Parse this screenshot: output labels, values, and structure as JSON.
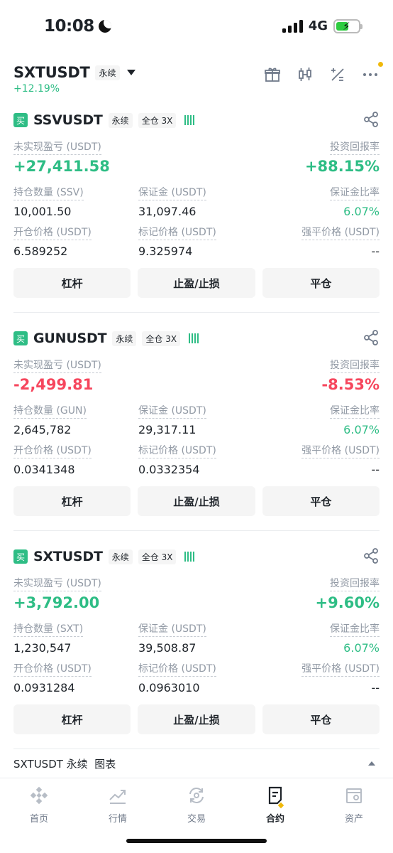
{
  "status_bar": {
    "time": "10:08",
    "network": "4G"
  },
  "header": {
    "symbol": "SXTUSDT",
    "tag": "永续",
    "change": "+12.19%",
    "icons": [
      "gift-icon",
      "candlestick-icon",
      "calculator-icon",
      "more-icon"
    ]
  },
  "labels": {
    "unrealized_pnl": "未实现盈亏 (USDT)",
    "roi": "投资回报率",
    "margin": "保证金 (USDT)",
    "margin_ratio": "保证金比率",
    "entry_price": "开仓价格 (USDT)",
    "mark_price": "标记价格 (USDT)",
    "liq_price": "强平价格 (USDT)"
  },
  "buttons": {
    "leverage": "杠杆",
    "tpsl": "止盈/止损",
    "close": "平仓"
  },
  "positions": [
    {
      "side": "买",
      "symbol": "SSVUSDT",
      "type": "永续",
      "margin_mode": "全仓 3X",
      "pnl": "+27,411.58",
      "roi": "+88.15%",
      "size_label": "持仓数量 (SSV)",
      "size": "10,001.50",
      "margin": "31,097.46",
      "margin_ratio": "6.07%",
      "entry_price": "6.589252",
      "mark_price": "9.325974",
      "liq_price": "--",
      "pnl_color": "#2ebd85"
    },
    {
      "side": "买",
      "symbol": "GUNUSDT",
      "type": "永续",
      "margin_mode": "全仓 3X",
      "pnl": "-2,499.81",
      "roi": "-8.53%",
      "size_label": "持仓数量 (GUN)",
      "size": "2,645,782",
      "margin": "29,317.11",
      "margin_ratio": "6.07%",
      "entry_price": "0.0341348",
      "mark_price": "0.0332354",
      "liq_price": "--",
      "pnl_color": "#f6465d"
    },
    {
      "side": "买",
      "symbol": "SXTUSDT",
      "type": "永续",
      "margin_mode": "全仓 3X",
      "pnl": "+3,792.00",
      "roi": "+9.60%",
      "size_label": "持仓数量 (SXT)",
      "size": "1,230,547",
      "margin": "39,508.87",
      "margin_ratio": "6.07%",
      "entry_price": "0.0931284",
      "mark_price": "0.0963010",
      "liq_price": "--",
      "pnl_color": "#2ebd85"
    }
  ],
  "chart_bar": {
    "label": "SXTUSDT 永续  图表"
  },
  "bottom_nav": [
    {
      "label": "首页",
      "icon": "home-icon"
    },
    {
      "label": "行情",
      "icon": "markets-icon"
    },
    {
      "label": "交易",
      "icon": "trade-icon"
    },
    {
      "label": "合约",
      "icon": "futures-icon",
      "active": true
    },
    {
      "label": "资产",
      "icon": "wallet-icon"
    }
  ],
  "colors": {
    "green": "#2ebd85",
    "red": "#f6465d",
    "accent": "#f0b90b"
  }
}
